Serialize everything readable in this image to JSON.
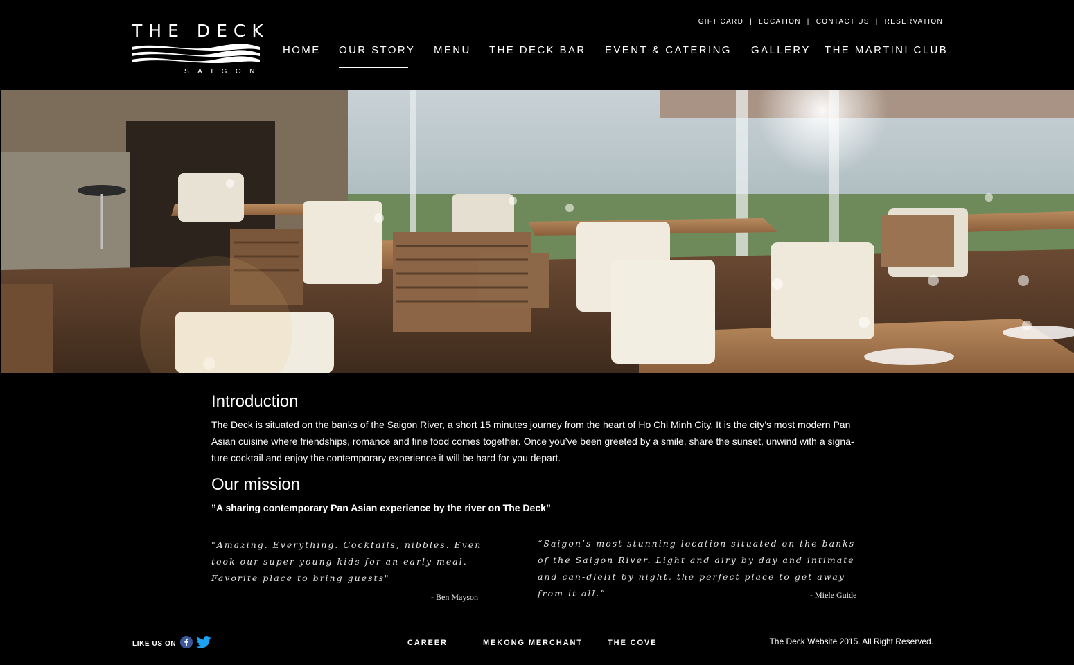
{
  "logo": {
    "title": "THE DECK",
    "subtitle": "SAIGON"
  },
  "utility_nav": [
    "GIFT CARD",
    "LOCATION",
    "CONTACT US",
    "RESERVATION"
  ],
  "utility_separator": "|",
  "main_nav": {
    "items": [
      "HOME",
      "OUR STORY",
      "MENU",
      "THE DECK BAR",
      "EVENT & CATERING",
      "GALLERY",
      "THE MARTINI CLUB"
    ],
    "active": "OUR STORY"
  },
  "intro": {
    "heading": "Introduction",
    "text": "The Deck is situated on the banks of the Saigon River, a short 15 minutes journey from the heart of Ho Chi Minh City. It is the city’s most modern Pan Asian cuisine where friendships, romance and fine food comes together. Once you’ve been greeted by a smile, share the sunset, unwind with a signa-ture cocktail and enjoy the contemporary experience it will be hard for you depart."
  },
  "mission": {
    "heading": "Our mission",
    "quote": "”A sharing contemporary Pan Asian experience by the river on The Deck”"
  },
  "reviews": [
    {
      "text": "\"Amazing. Everything. Cocktails, nibbles. Even took our super young kids for an early meal. Favorite place to bring guests\"",
      "author": "- Ben Mayson"
    },
    {
      "text": "“Saigon’s most stunning location situated on the banks of the Saigon River. Light and airy by day and intimate and can-dlelit by night, the perfect place to get away from it all.”",
      "author": "- Miele Guide"
    }
  ],
  "footer": {
    "like_label": "LIKE US ON",
    "social_icons": [
      "facebook-icon",
      "twitter-icon"
    ],
    "links": [
      "CAREER",
      "MEKONG MERCHANT",
      "THE COVE"
    ],
    "copyright": "The Deck Website 2015. All Right Reserved."
  },
  "colors": {
    "background": "#000000",
    "text": "#ffffff",
    "facebook": "#3b5998",
    "twitter": "#1da1f2",
    "divider": "#555555"
  }
}
